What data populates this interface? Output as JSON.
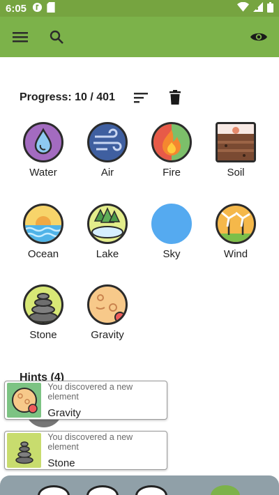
{
  "status_bar": {
    "time": "6:05"
  },
  "progress": {
    "text": "Progress: 10 / 401"
  },
  "elements": [
    {
      "name": "Water"
    },
    {
      "name": "Air"
    },
    {
      "name": "Fire"
    },
    {
      "name": "Soil"
    },
    {
      "name": "Ocean"
    },
    {
      "name": "Lake"
    },
    {
      "name": "Sky"
    },
    {
      "name": "Wind"
    },
    {
      "name": "Stone"
    },
    {
      "name": "Gravity"
    }
  ],
  "hints": {
    "title": "Hints (4)"
  },
  "toasts": [
    {
      "message": "You discovered a new element",
      "element": "Gravity",
      "bg": "#7cc383"
    },
    {
      "message": "You discovered a new element",
      "element": "Stone",
      "bg": "#c8dc6e"
    }
  ],
  "colors": {
    "primary": "#7cb24a",
    "status": "#76a440"
  },
  "icons": {
    "menu": "menu-icon",
    "search": "search-icon",
    "visibility": "eye-icon",
    "sort": "sort-icon",
    "delete": "trash-icon"
  }
}
